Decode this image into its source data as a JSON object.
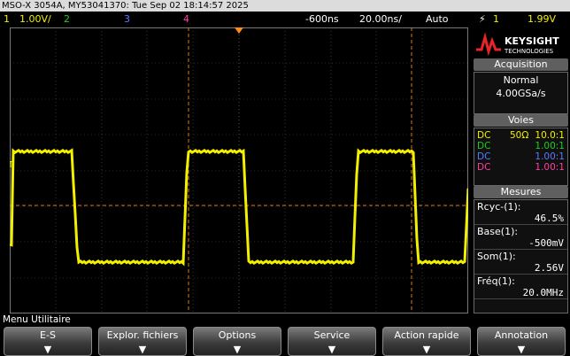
{
  "window": {
    "title": "MSO-X 3054A, MY53041370: Tue Sep 02 18:14:57 2025"
  },
  "channels_bar": {
    "ch1_num": "1",
    "ch1_scale": "1.00V/",
    "ch2_num": "2",
    "ch3_num": "3",
    "ch4_num": "4",
    "time_offset": "-600ns",
    "time_scale": "20.00ns/",
    "trigger_mode": "Auto",
    "trigger_icon": "trigger-edge-icon",
    "trigger_ch": "1",
    "trigger_level": "1.99V"
  },
  "logo": {
    "brand": "KEYSIGHT",
    "sub": "TECHNOLOGIES"
  },
  "acquisition": {
    "title": "Acquisition",
    "mode": "Normal",
    "rate": "4.00GSa/s"
  },
  "voies": {
    "title": "Voies",
    "rows": [
      {
        "coupling": "DC",
        "impedance": "50Ω",
        "probe": "10.0:1",
        "color": "#f2f000"
      },
      {
        "coupling": "DC",
        "impedance": "",
        "probe": "1.00:1",
        "color": "#22cc22"
      },
      {
        "coupling": "DC",
        "impedance": "",
        "probe": "1.00:1",
        "color": "#5a7bff"
      },
      {
        "coupling": "DC",
        "impedance": "",
        "probe": "1.00:1",
        "color": "#ff3fa0"
      }
    ]
  },
  "mesures": {
    "title": "Mesures",
    "items": [
      {
        "label": "Rcyc-(1):",
        "value": "46.5%"
      },
      {
        "label": "Base(1):",
        "value": "-500mV"
      },
      {
        "label": "Som(1):",
        "value": "2.56V"
      },
      {
        "label": "Fréq(1):",
        "value": "20.0MHz"
      }
    ]
  },
  "menu": {
    "title": "Menu Utilitaire",
    "softkeys": [
      "E-S",
      "Explor. fichiers",
      "Options",
      "Service",
      "Action rapide",
      "Annotation"
    ]
  },
  "colors": {
    "ch1": "#f2f000",
    "ch2": "#22cc22",
    "ch3": "#5a7bff",
    "ch4": "#ff3fa0",
    "cursor": "#e07a10",
    "grid": "#5a5a5a"
  }
}
